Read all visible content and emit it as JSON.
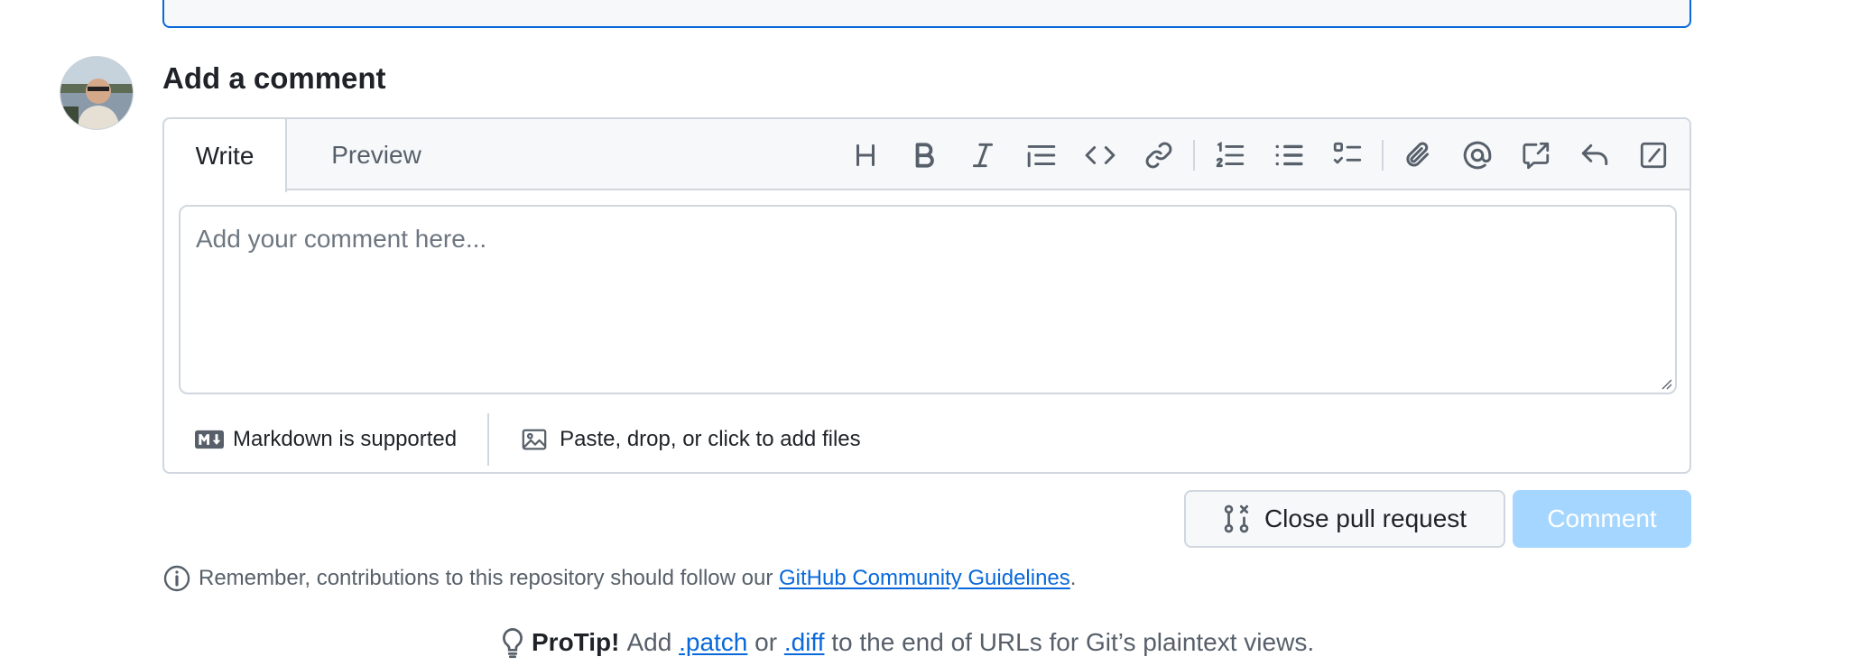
{
  "comment": {
    "title": "Add a comment",
    "tabs": {
      "write": "Write",
      "preview": "Preview"
    },
    "toolbar_icons": [
      "heading-icon",
      "bold-icon",
      "italic-icon",
      "quote-icon",
      "code-icon",
      "link-icon",
      "ordered-list-icon",
      "unordered-list-icon",
      "task-list-icon",
      "attach-icon",
      "mention-icon",
      "reference-icon",
      "reply-icon",
      "saved-replies-icon"
    ],
    "placeholder": "Add your comment here...",
    "markdown_note": "Markdown is supported",
    "files_note": "Paste, drop, or click to add files"
  },
  "actions": {
    "close_pr": "Close pull request",
    "comment": "Comment"
  },
  "footer": {
    "remember_prefix": "Remember, contributions to this repository should follow our ",
    "guidelines_link": "GitHub Community Guidelines",
    "remember_suffix": ".",
    "protip_label": "ProTip!",
    "protip_1": "Add",
    "protip_patch": ".patch",
    "protip_or": "or",
    "protip_diff": ".diff",
    "protip_2": "to the end of URLs for Git’s plaintext views."
  },
  "colors": {
    "accent": "#0969da",
    "border": "#d0d7de",
    "comment_button_disabled": "#a5d6ff"
  }
}
